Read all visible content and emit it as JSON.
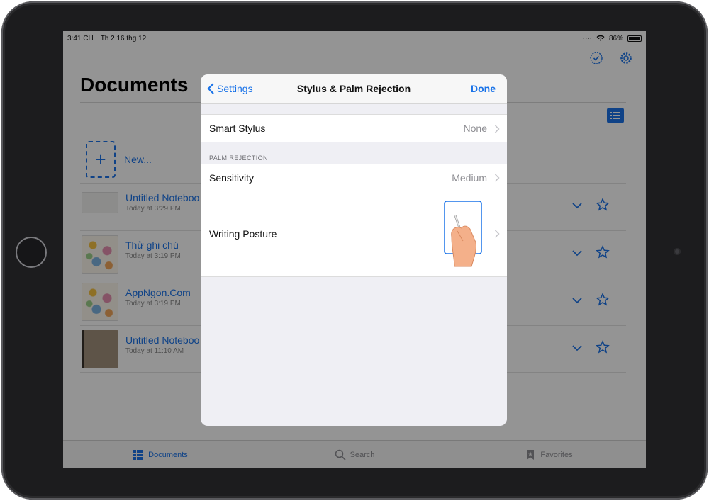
{
  "status_bar": {
    "time": "3:41 CH",
    "date": "Th 2 16 thg 12",
    "battery": "86%"
  },
  "background": {
    "title": "Documents",
    "new_label": "New...",
    "new_plus": "+",
    "documents": [
      {
        "title": "Untitled Noteboo",
        "meta": "Today at 3:29 PM",
        "thumb": "blank"
      },
      {
        "title": "Thử ghi chú",
        "meta": "Today at 3:19 PM",
        "thumb": "floral"
      },
      {
        "title": "AppNgon.Com",
        "meta": "Today at 3:19 PM",
        "thumb": "floral"
      },
      {
        "title": "Untitled Noteboo",
        "meta": "Today at 11:10 AM",
        "thumb": "brown"
      }
    ],
    "tabs": [
      {
        "label": "Documents",
        "icon": "grid-icon",
        "active": true
      },
      {
        "label": "Search",
        "icon": "search-icon",
        "active": false
      },
      {
        "label": "Favorites",
        "icon": "bookmark-star-icon",
        "active": false
      }
    ]
  },
  "modal": {
    "back_label": "Settings",
    "title": "Stylus & Palm Rejection",
    "done_label": "Done",
    "smart_stylus": {
      "label": "Smart Stylus",
      "value": "None"
    },
    "palm_rejection_header": "PALM REJECTION",
    "sensitivity": {
      "label": "Sensitivity",
      "value": "Medium"
    },
    "writing_posture": {
      "label": "Writing Posture"
    }
  },
  "colors": {
    "accent": "#1a73e8",
    "dim_overlay": "rgba(0,0,0,0.42)"
  }
}
